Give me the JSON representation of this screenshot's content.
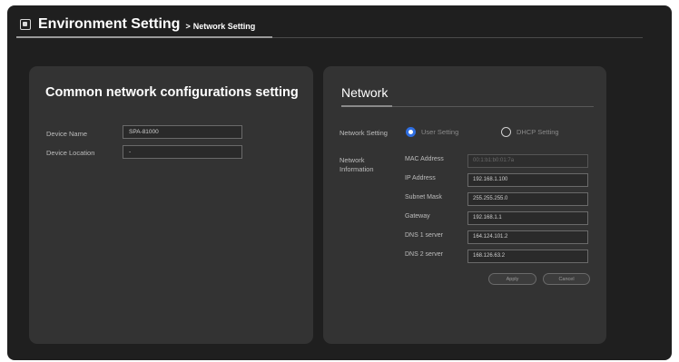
{
  "header": {
    "title": "Environment Setting",
    "breadcrumb_arrow": ">",
    "breadcrumb": "Network Setting"
  },
  "common": {
    "title": "Common network configurations setting",
    "device_name_label": "Device Name",
    "device_name_value": "SPA-81000",
    "device_location_label": "Device Location",
    "device_location_value": "-"
  },
  "network": {
    "title": "Network",
    "setting_label": "Network Setting",
    "options": [
      {
        "label": "User Setting",
        "selected": true
      },
      {
        "label": "DHCP Setting",
        "selected": false
      }
    ],
    "info_label_line1": "Network",
    "info_label_line2": "Information",
    "fields": [
      {
        "label": "MAC Address",
        "value": "00:1:b1:b0:01:7a",
        "disabled": true
      },
      {
        "label": "IP Address",
        "value": "192.168.1.100",
        "disabled": false
      },
      {
        "label": "Subnet Mask",
        "value": "255.255.255.0",
        "disabled": false
      },
      {
        "label": "Gateway",
        "value": "192.168.1.1",
        "disabled": false
      },
      {
        "label": "DNS 1 server",
        "value": "164.124.101.2",
        "disabled": false
      },
      {
        "label": "DNS 2 server",
        "value": "168.126.63.2",
        "disabled": false
      }
    ],
    "apply_label": "Apply",
    "cancel_label": "Cancel"
  },
  "colors": {
    "background": "#1f1f1f",
    "panel": "#333333",
    "accent_radio": "#2f6ee0"
  },
  "icons": {
    "header": "settings-square-icon"
  }
}
